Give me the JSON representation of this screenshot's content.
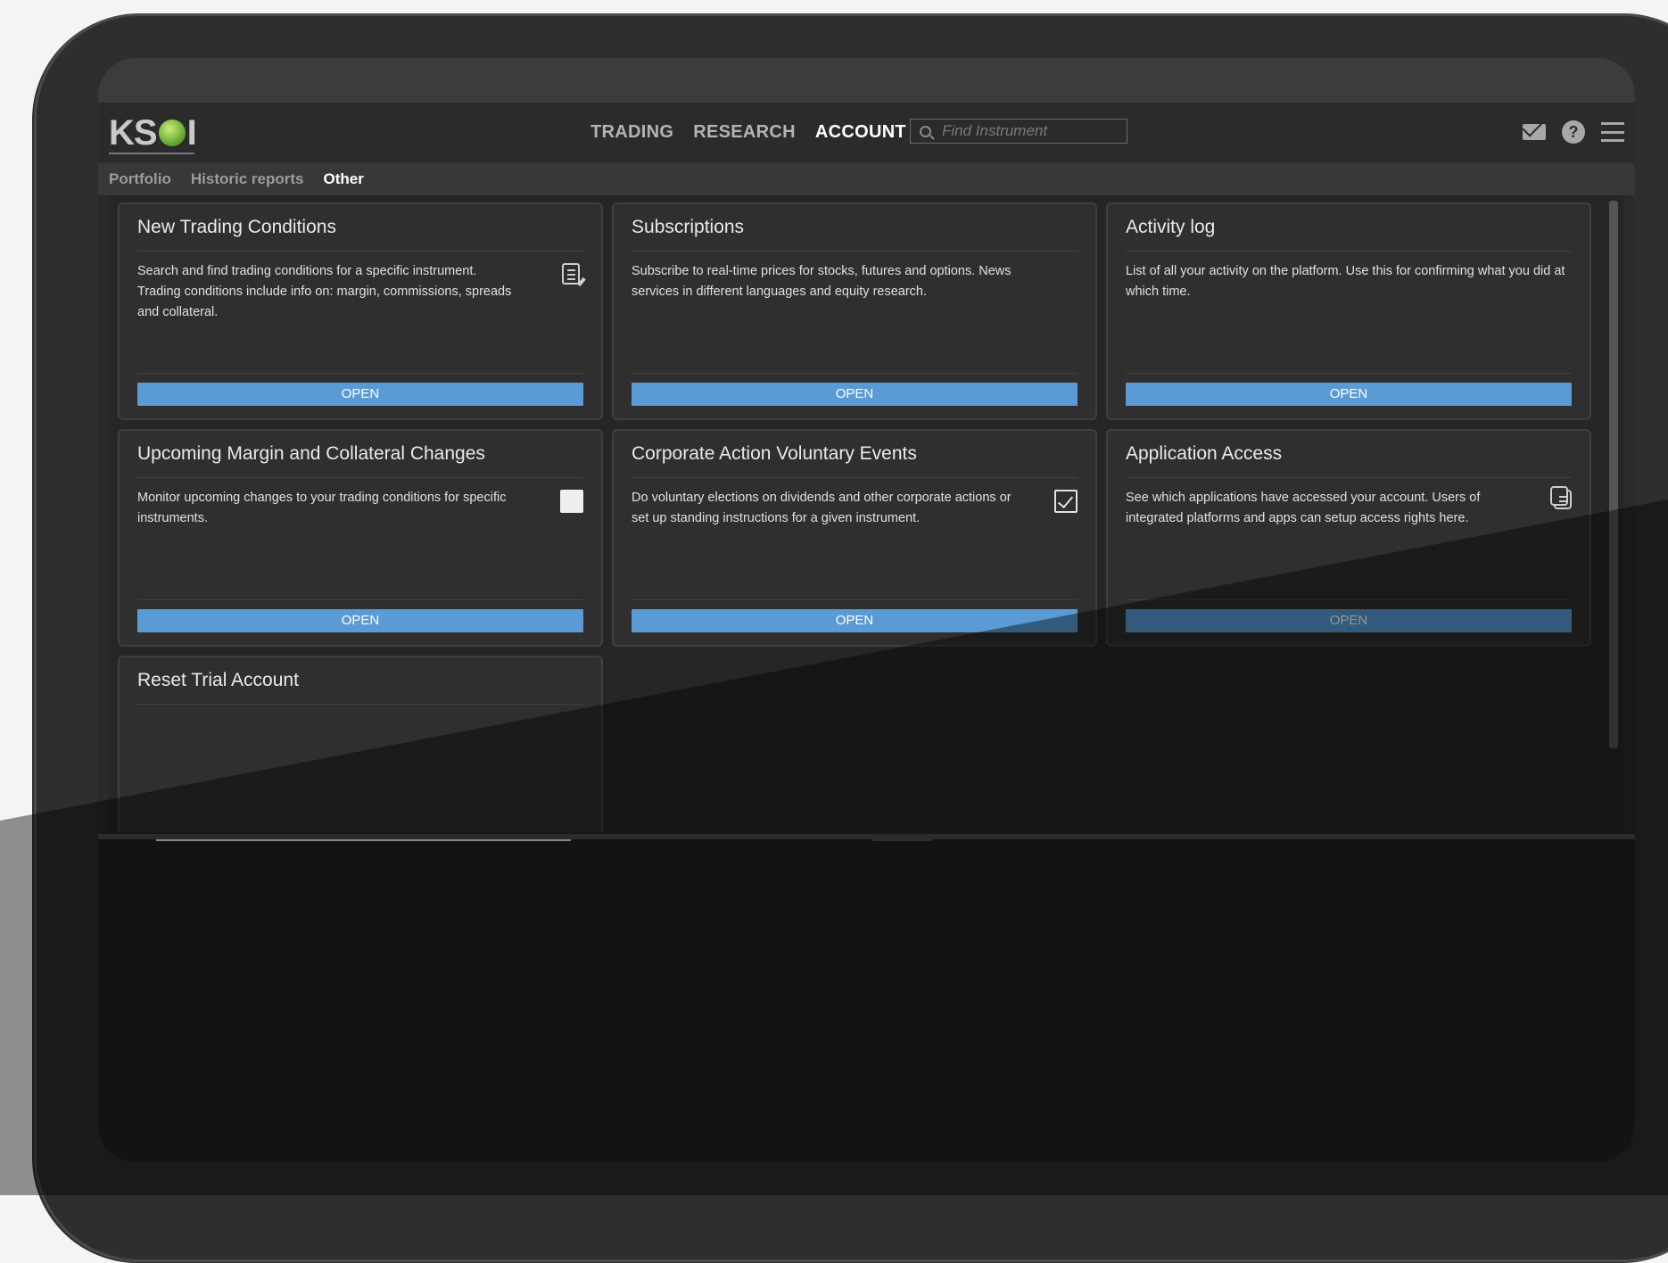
{
  "logo": {
    "text": "KS",
    "text_after": "I"
  },
  "nav": {
    "items": [
      {
        "label": "TRADING",
        "active": false
      },
      {
        "label": "RESEARCH",
        "active": false
      },
      {
        "label": "ACCOUNT",
        "active": true
      }
    ]
  },
  "search": {
    "placeholder": "Find Instrument",
    "value": ""
  },
  "subnav": {
    "items": [
      {
        "label": "Portfolio",
        "active": false
      },
      {
        "label": "Historic reports",
        "active": false
      },
      {
        "label": "Other",
        "active": true
      }
    ]
  },
  "cards": [
    {
      "title": "New Trading Conditions",
      "description": "Search and find trading conditions for a specific instrument. Trading conditions include info on: margin, commissions, spreads and collateral.",
      "icon": "edit-note-icon",
      "button": "OPEN"
    },
    {
      "title": "Subscriptions",
      "description": "Subscribe to real-time prices for stocks, futures and options. News services in different languages and equity research.",
      "icon": "",
      "button": "OPEN"
    },
    {
      "title": "Activity log",
      "description": "List of all your activity on the platform. Use this for confirming what you did at which time.",
      "icon": "",
      "button": "OPEN"
    },
    {
      "title": "Upcoming Margin and Collateral Changes",
      "description": "Monitor upcoming changes to your trading conditions for specific instruments.",
      "icon": "square-icon",
      "button": "OPEN"
    },
    {
      "title": "Corporate Action Voluntary Events",
      "description": "Do voluntary elections on dividends and other corporate actions or set up standing instructions for a given instrument.",
      "icon": "checkbox-icon",
      "button": "OPEN"
    },
    {
      "title": "Application Access",
      "description": "See which applications have accessed your account. Users of integrated platforms and apps can setup access rights here.",
      "icon": "copy-icon",
      "button": "OPEN"
    },
    {
      "title": "Reset Trial Account",
      "description": "",
      "icon": "",
      "button": ""
    }
  ],
  "colors": {
    "button": "#5b9bd5",
    "background": "#262626",
    "card": "#2f2f2f"
  }
}
